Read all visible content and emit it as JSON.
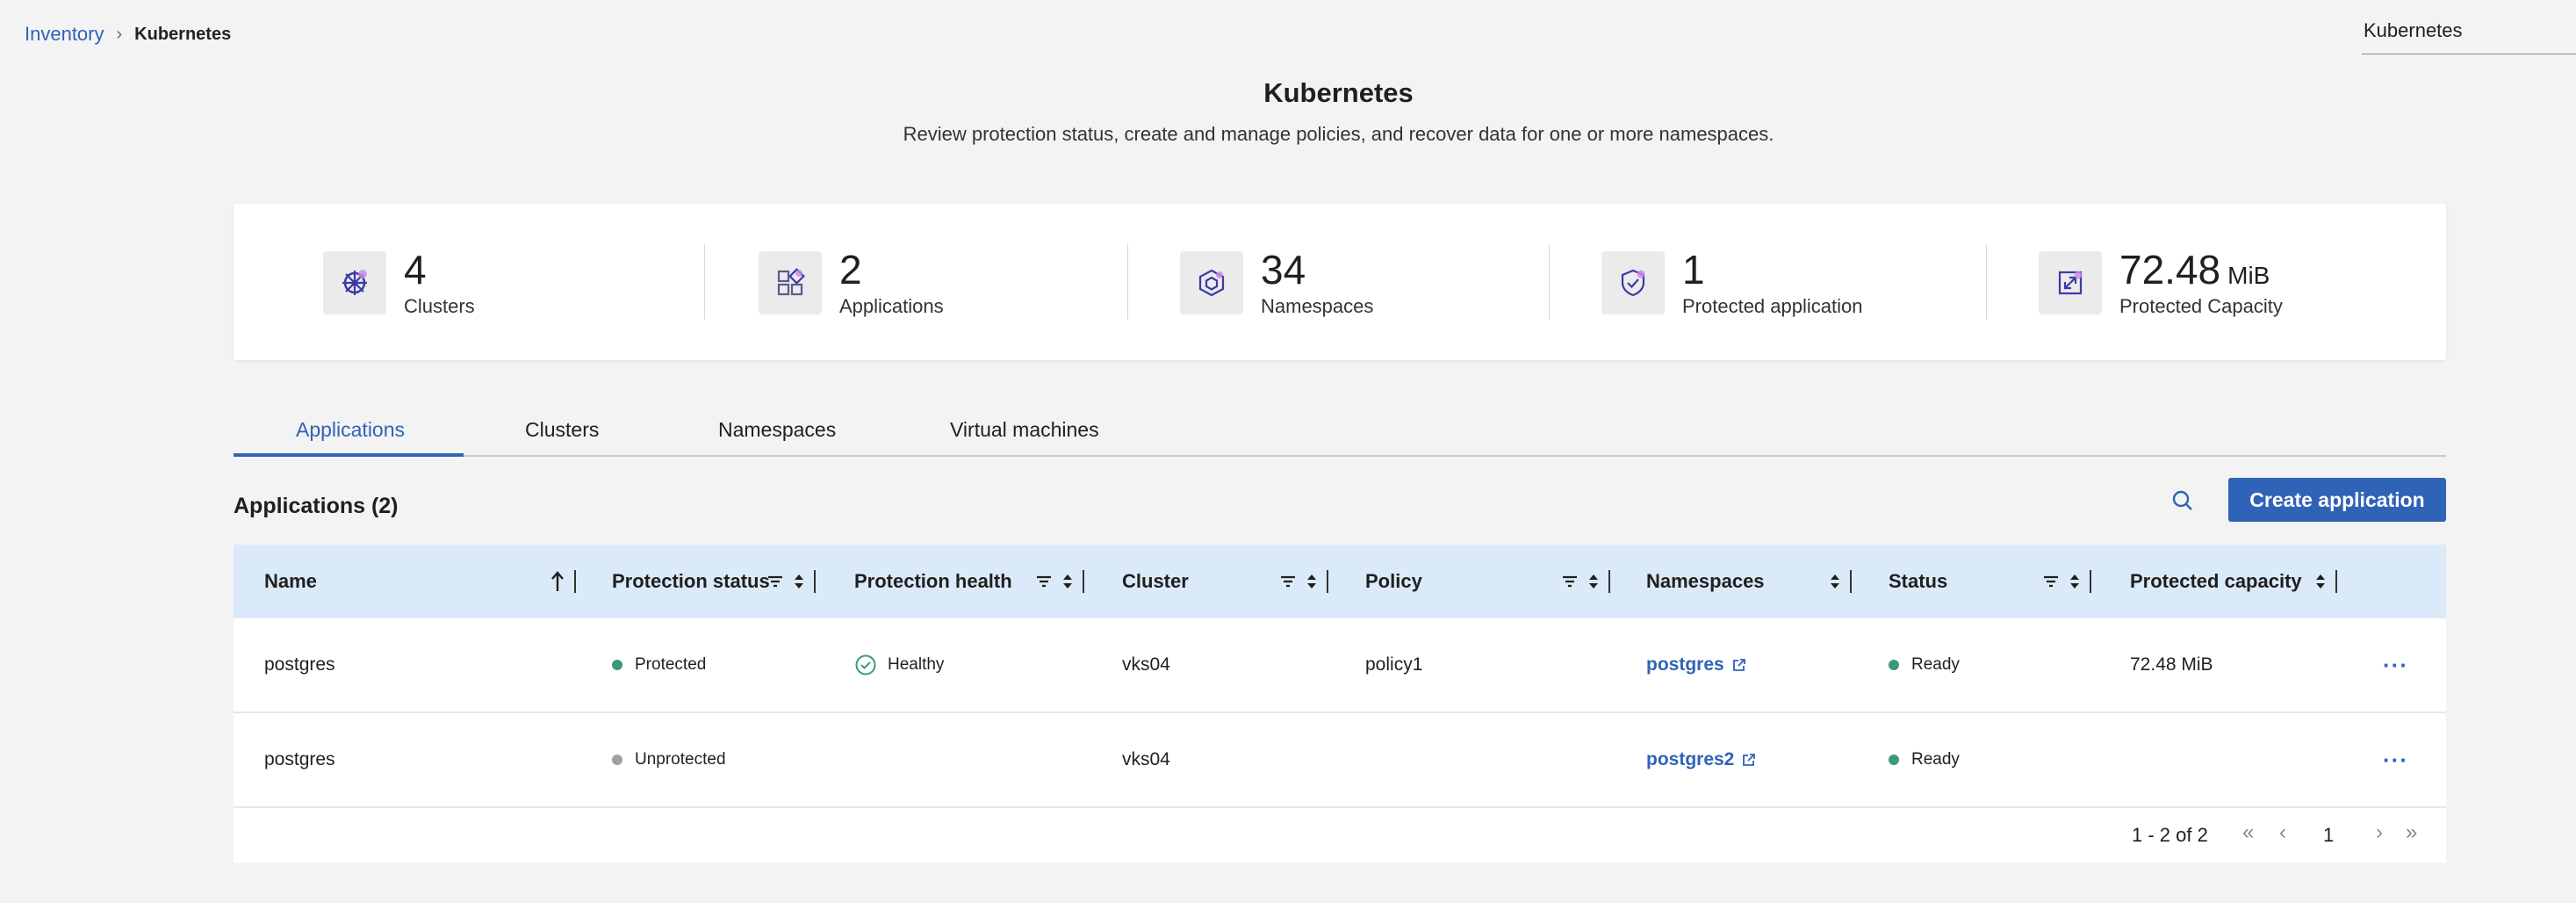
{
  "breadcrumb": {
    "root": "Inventory",
    "separator": "›",
    "current": "Kubernetes"
  },
  "context_selector": {
    "value": "Kubernetes"
  },
  "header": {
    "title": "Kubernetes",
    "subtitle": "Review protection status, create and manage policies, and recover data for one or more namespaces."
  },
  "summary": {
    "clusters": {
      "value": "4",
      "label": "Clusters",
      "icon": "helm-wheel-icon"
    },
    "applications": {
      "value": "2",
      "label": "Applications",
      "icon": "apps-grid-icon"
    },
    "namespaces": {
      "value": "34",
      "label": "Namespaces",
      "icon": "cube-icon"
    },
    "protected_apps": {
      "value": "1",
      "label": "Protected application",
      "icon": "shield-check-icon"
    },
    "capacity": {
      "value": "72.48",
      "unit": "MiB",
      "label": "Protected Capacity",
      "icon": "expand-icon"
    }
  },
  "tabs": [
    {
      "label": "Applications",
      "active": true
    },
    {
      "label": "Clusters",
      "active": false
    },
    {
      "label": "Namespaces",
      "active": false
    },
    {
      "label": "Virtual machines",
      "active": false
    }
  ],
  "section": {
    "title": "Applications (2)",
    "create_label": "Create application"
  },
  "table": {
    "columns": [
      "Name",
      "Protection status",
      "Protection health",
      "Cluster",
      "Policy",
      "Namespaces",
      "Status",
      "Protected capacity"
    ],
    "rows": [
      {
        "name": "postgres",
        "protection_status": "Protected",
        "protection_health": "Healthy",
        "cluster": "vks04",
        "policy": "policy1",
        "namespace": "postgres",
        "status": "Ready",
        "capacity": "72.48 MiB",
        "more": "···"
      },
      {
        "name": "postgres",
        "protection_status": "Unprotected",
        "protection_health": "",
        "cluster": "vks04",
        "policy": "",
        "namespace": "postgres2",
        "status": "Ready",
        "capacity": "",
        "more": "···"
      }
    ]
  },
  "pagination": {
    "range": "1 - 2 of 2",
    "page": "1"
  },
  "colors": {
    "accent": "#2f63b8",
    "protected": "#3a9b77",
    "unprotected": "#a0a0a0",
    "ready": "#3a9b77",
    "header_bg": "#dbeaf8"
  }
}
